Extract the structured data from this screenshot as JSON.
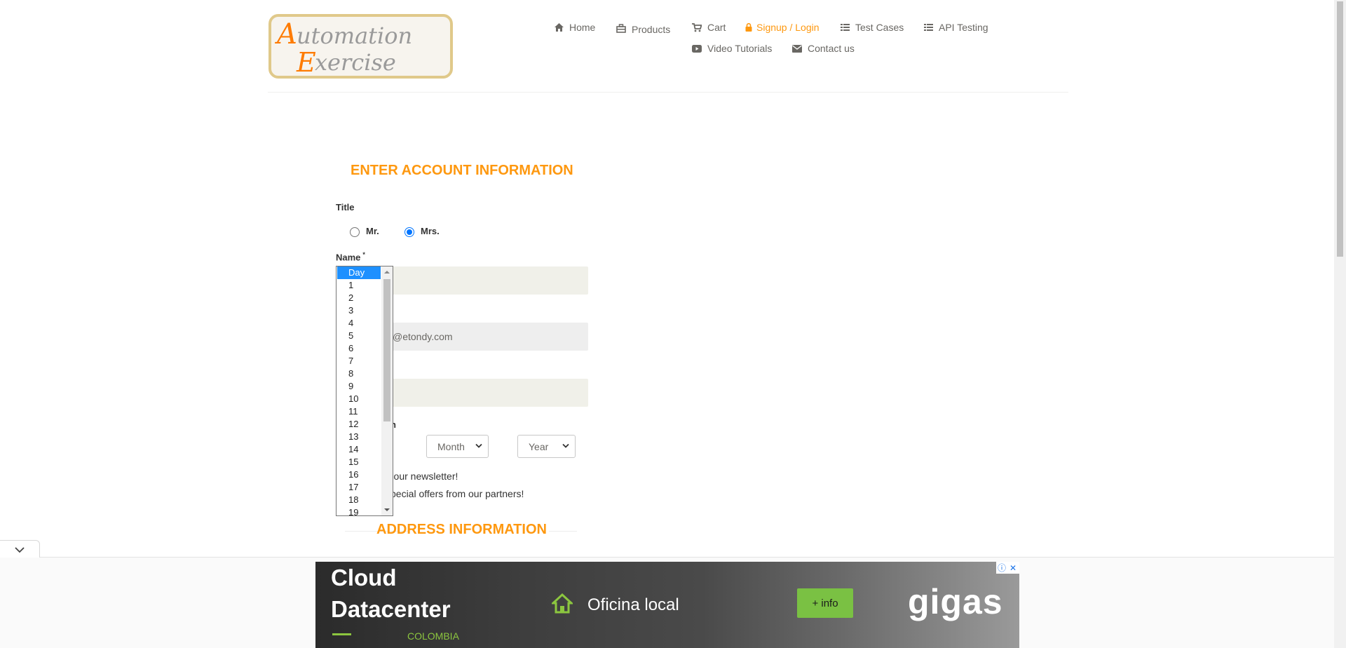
{
  "logo": {
    "line1": "Automation",
    "line2": "Exercise",
    "alt": "Automation Exercise"
  },
  "nav": {
    "home": "Home",
    "products": "Products",
    "cart": "Cart",
    "signup": "Signup / Login",
    "test_cases": "Test Cases",
    "api_testing": "API Testing",
    "video_tutorials": "Video Tutorials",
    "contact": "Contact us",
    "active_color": "#fe980f"
  },
  "form": {
    "section_title": "ENTER ACCOUNT INFORMATION",
    "title_label": "Title",
    "title_options": [
      "Mr.",
      "Mrs."
    ],
    "title_selected": "Mrs.",
    "name_label": "Name",
    "required_mark": "*",
    "email_value_visible": "@etondy.com",
    "dob_label_fragment": "h",
    "month_placeholder": "Month",
    "year_placeholder": "Year",
    "newsletter_fragment": "r our newsletter!",
    "offers_fragment": "pecial offers from our partners!",
    "address_title": "ADDRESS INFORMATION"
  },
  "day_dropdown": {
    "selected": "Day",
    "options": [
      "Day",
      "1",
      "2",
      "3",
      "4",
      "5",
      "6",
      "7",
      "8",
      "9",
      "10",
      "11",
      "12",
      "13",
      "14",
      "15",
      "16",
      "17",
      "18",
      "19"
    ]
  },
  "ad": {
    "title_line1": "Cloud",
    "title_line2": "Datacenter",
    "subtitle": "COLOMBIA",
    "office": "Oficina local",
    "button": "+ info",
    "brand": "gigas",
    "info_icon": "ⓘ",
    "close_icon": "✕",
    "accent": "#8cc63f"
  }
}
